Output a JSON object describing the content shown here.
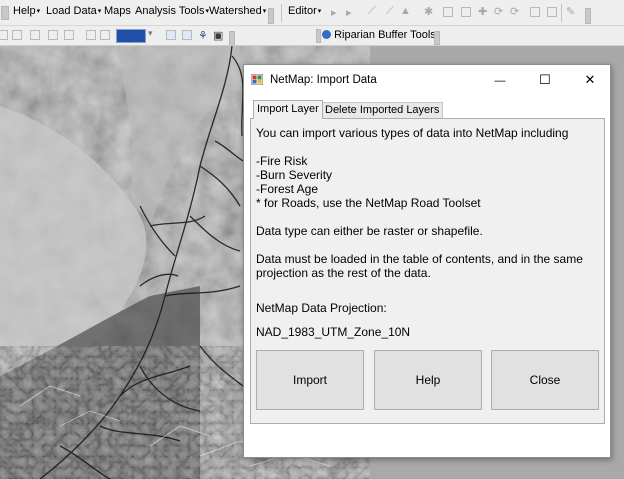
{
  "toolbar": {
    "menus": [
      {
        "label": "Help",
        "has_dropdown": true
      },
      {
        "label": "Load Data",
        "has_dropdown": true
      },
      {
        "label": "Maps",
        "has_dropdown": false
      },
      {
        "label": "Analysis Tools",
        "has_dropdown": true
      },
      {
        "label": "Watershed",
        "has_dropdown": true
      }
    ],
    "editor_label": "Editor",
    "riparian_label": "Riparian Buffer Tools",
    "dropdown_arrow": "▾"
  },
  "dialog": {
    "title": "NetMap: Import Data",
    "window_controls": {
      "minimize": "—",
      "maximize": "☐",
      "close": "✕"
    },
    "tabs": [
      {
        "label": "Import Layer",
        "active": true
      },
      {
        "label": "Delete Imported Layers",
        "active": false
      }
    ],
    "body": {
      "intro": "You can import various types of data into NetMap including",
      "items": [
        "-Fire Risk",
        "-Burn Severity",
        "-Forest Age",
        "* for Roads, use the NetMap Road Toolset"
      ],
      "datatype_note": "Data type can either be raster or shapefile.",
      "loaded_note_line1": "Data must be loaded in the table of contents, and in the same",
      "loaded_note_line2": "projection as the rest of the data.",
      "projection_label": "NetMap Data Projection:",
      "projection_value": "NAD_1983_UTM_Zone_10N"
    },
    "buttons": {
      "import": "Import",
      "help": "Help",
      "close": "Close"
    }
  },
  "colors": {
    "titlebar_bg": "#ffffff",
    "panel_bg": "#f0f0f0",
    "button_bg": "#e1e1e1",
    "toolbar_bg": "#eeeeee",
    "map_accent": "#1f1f1f"
  }
}
